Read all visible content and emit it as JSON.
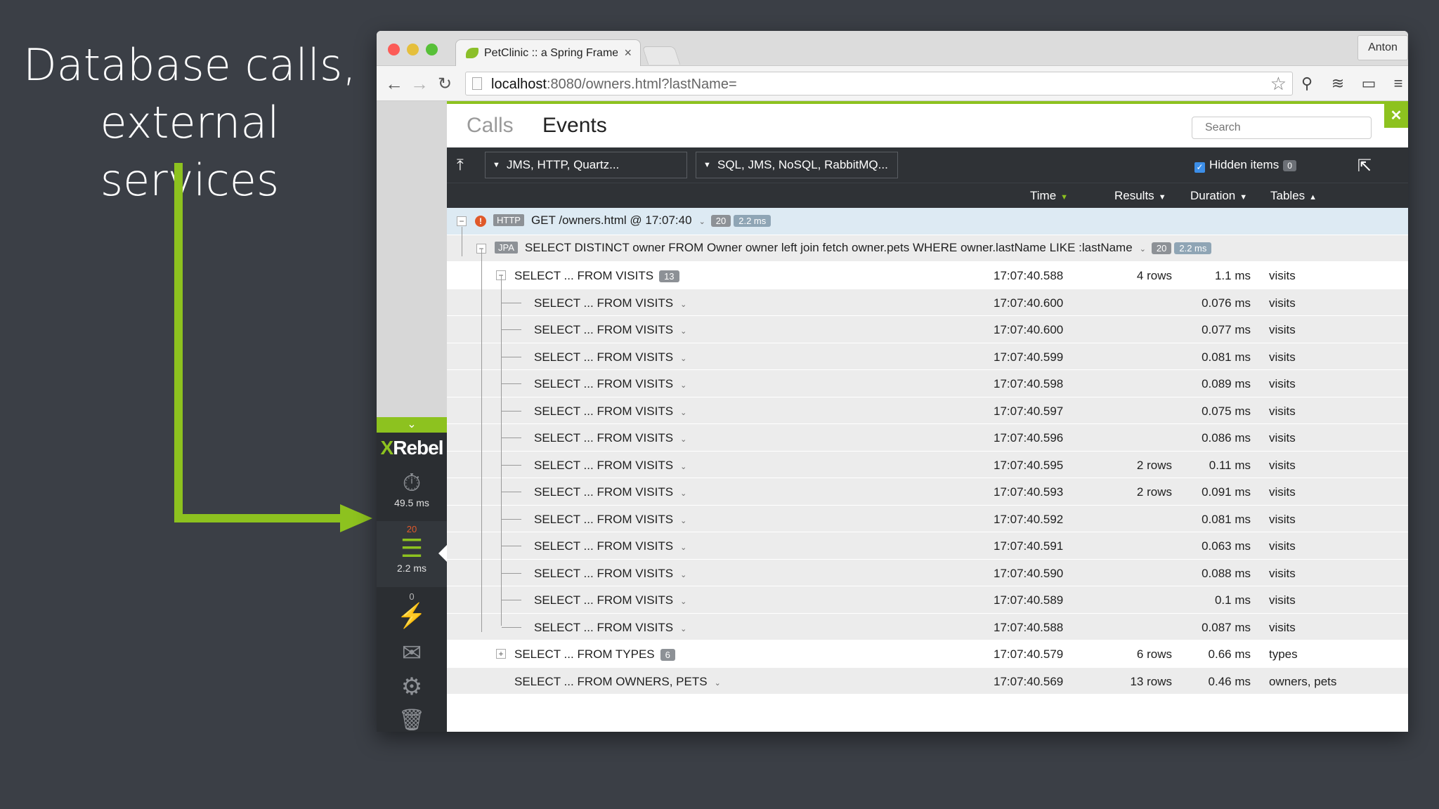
{
  "slide": {
    "title_line1": "Database calls,",
    "title_line2": "external services"
  },
  "browser": {
    "tab_title": "PetClinic :: a Spring Frame",
    "tab_close": "×",
    "user": "Anton",
    "url_host": "localhost",
    "url_rest": ":8080/owners.html?lastName="
  },
  "xrebel": {
    "logo_x": "X",
    "logo_rest": "Rebel",
    "timing_value": "49.5 ms",
    "db_count": "20",
    "db_time": "2.2 ms",
    "external_count": "0"
  },
  "panel": {
    "tab_calls": "Calls",
    "tab_events": "Events",
    "search_placeholder": "Search",
    "filter1": "JMS, HTTP, Quartz...",
    "filter2": "SQL, JMS, NoSQL, RabbitMQ...",
    "hidden_items_label": "Hidden items",
    "hidden_items_count": "0",
    "columns": {
      "time": "Time",
      "results": "Results",
      "duration": "Duration",
      "tables": "Tables"
    }
  },
  "events": {
    "http": {
      "tag": "HTTP",
      "label": "GET /owners.html @ 17:07:40",
      "count": "20",
      "ms": "2.2 ms"
    },
    "jpa": {
      "tag": "JPA",
      "label": "SELECT DISTINCT owner FROM Owner owner left join fetch owner.pets WHERE owner.lastName LIKE :lastName",
      "count": "20",
      "ms": "2.2 ms"
    },
    "visits_group": {
      "label": "SELECT ... FROM VISITS",
      "count": "13",
      "time": "17:07:40.588",
      "results": "4 rows",
      "duration": "1.1 ms",
      "tables": "visits"
    },
    "visits_children": [
      {
        "label": "SELECT ... FROM VISITS",
        "time": "17:07:40.600",
        "results": "",
        "duration": "0.076 ms",
        "tables": "visits"
      },
      {
        "label": "SELECT ... FROM VISITS",
        "time": "17:07:40.600",
        "results": "",
        "duration": "0.077 ms",
        "tables": "visits"
      },
      {
        "label": "SELECT ... FROM VISITS",
        "time": "17:07:40.599",
        "results": "",
        "duration": "0.081 ms",
        "tables": "visits"
      },
      {
        "label": "SELECT ... FROM VISITS",
        "time": "17:07:40.598",
        "results": "",
        "duration": "0.089 ms",
        "tables": "visits"
      },
      {
        "label": "SELECT ... FROM VISITS",
        "time": "17:07:40.597",
        "results": "",
        "duration": "0.075 ms",
        "tables": "visits"
      },
      {
        "label": "SELECT ... FROM VISITS",
        "time": "17:07:40.596",
        "results": "",
        "duration": "0.086 ms",
        "tables": "visits"
      },
      {
        "label": "SELECT ... FROM VISITS",
        "time": "17:07:40.595",
        "results": "2 rows",
        "duration": "0.11 ms",
        "tables": "visits"
      },
      {
        "label": "SELECT ... FROM VISITS",
        "time": "17:07:40.593",
        "results": "2 rows",
        "duration": "0.091 ms",
        "tables": "visits"
      },
      {
        "label": "SELECT ... FROM VISITS",
        "time": "17:07:40.592",
        "results": "",
        "duration": "0.081 ms",
        "tables": "visits"
      },
      {
        "label": "SELECT ... FROM VISITS",
        "time": "17:07:40.591",
        "results": "",
        "duration": "0.063 ms",
        "tables": "visits"
      },
      {
        "label": "SELECT ... FROM VISITS",
        "time": "17:07:40.590",
        "results": "",
        "duration": "0.088 ms",
        "tables": "visits"
      },
      {
        "label": "SELECT ... FROM VISITS",
        "time": "17:07:40.589",
        "results": "",
        "duration": "0.1 ms",
        "tables": "visits"
      },
      {
        "label": "SELECT ... FROM VISITS",
        "time": "17:07:40.588",
        "results": "",
        "duration": "0.087 ms",
        "tables": "visits"
      }
    ],
    "types_group": {
      "label": "SELECT ... FROM TYPES",
      "count": "6",
      "time": "17:07:40.579",
      "results": "6 rows",
      "duration": "0.66 ms",
      "tables": "types"
    },
    "owners_row": {
      "label": "SELECT ... FROM OWNERS, PETS",
      "time": "17:07:40.569",
      "results": "13 rows",
      "duration": "0.46 ms",
      "tables": "owners, pets"
    }
  },
  "colors": {
    "accent_green": "#8dc21f",
    "warning_orange": "#e0592a",
    "dark_bar": "#2f3236",
    "background": "#3b3f46"
  }
}
